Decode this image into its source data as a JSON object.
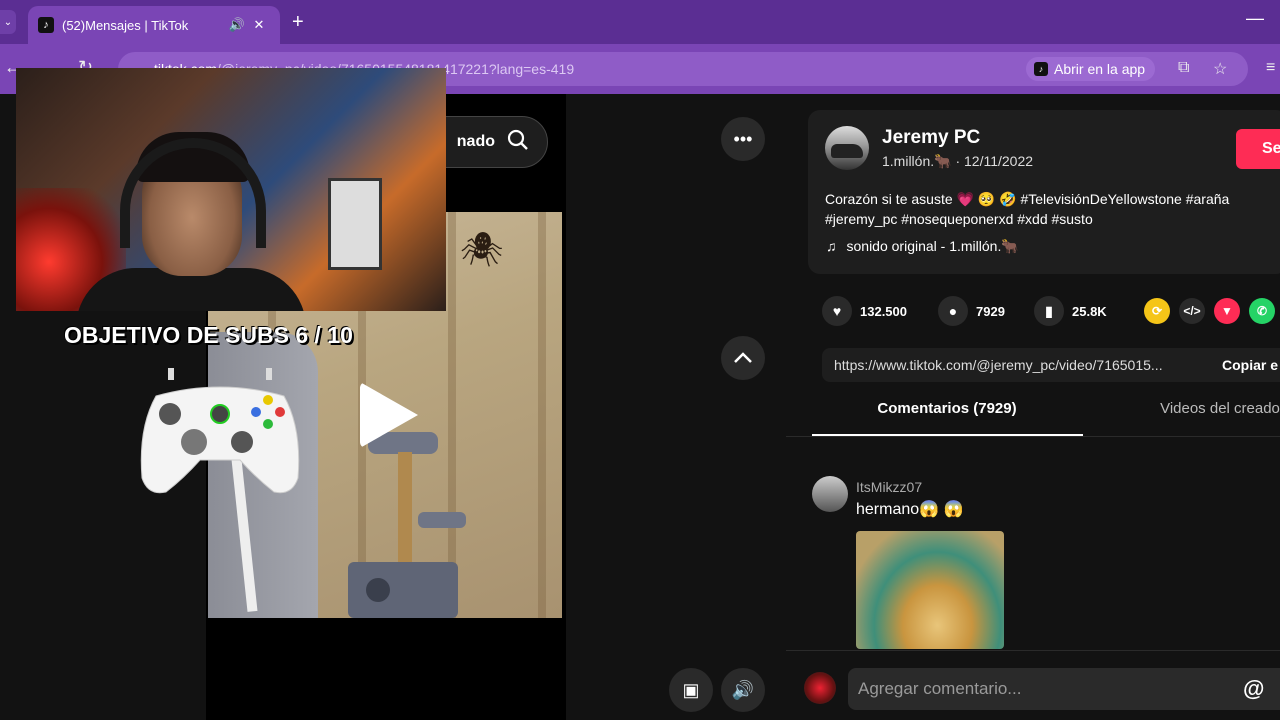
{
  "browser": {
    "tab_title": "(52)Mensajes | TikTok",
    "new_tab": "+",
    "url_host": "tiktok.com",
    "url_rest": "/@jeremy_pc/video/7165015548181417221?lang=es-419",
    "open_app": "Abrir en la app"
  },
  "video_page": {
    "search_partial": "nado",
    "play_label": "play"
  },
  "overlay": {
    "subs_goal": "OBJETIVO DE SUBS 6 / 10"
  },
  "post": {
    "author": "Jeremy PC",
    "author_sub": "1.millón.🐂 · 12/11/2022",
    "follow": "Se",
    "description": "Corazón si te asuste 💗 🥺 🤣 #TelevisiónDeYellowstone #araña #jeremy_pc #nosequeponerxd #xdd #susto",
    "sound": "sonido original - 1.millón.🐂",
    "likes": "132.500",
    "comments": "7929",
    "saves": "25.8K",
    "link": "https://www.tiktok.com/@jeremy_pc/video/7165015...",
    "copy": "Copiar e"
  },
  "tabs": {
    "comments": "Comentarios (7929)",
    "videos": "Videos del creado"
  },
  "comment": {
    "user": "ItsMikzz07",
    "text": "hermano😱 😱"
  },
  "input": {
    "placeholder": "Agregar comentario..."
  },
  "colors": {
    "brand": "#fe2c55",
    "chrome": "#7a45b5"
  }
}
